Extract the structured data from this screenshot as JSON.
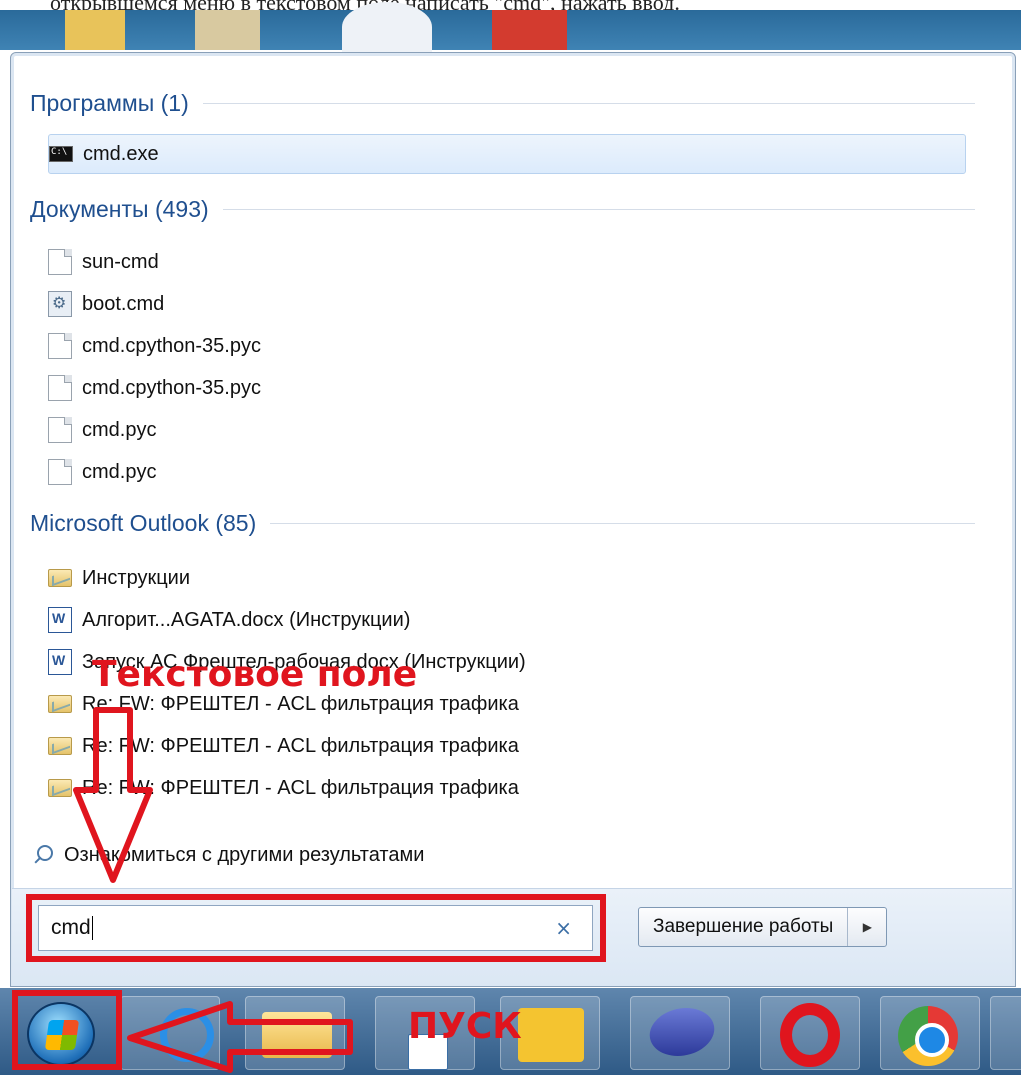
{
  "caption": {
    "text": "открывшемся меню в текстовом поле написать \"cmd\", нажать ввод."
  },
  "start_menu": {
    "sections": [
      {
        "heading": "Программы (1)",
        "items": [
          {
            "label": "cmd.exe",
            "icon": "cmd-icon",
            "selected": true
          }
        ]
      },
      {
        "heading": "Документы (493)",
        "items": [
          {
            "label": "sun-cmd",
            "icon": "document-icon"
          },
          {
            "label": "boot.cmd",
            "icon": "settings-file-icon"
          },
          {
            "label": "cmd.cpython-35.pyc",
            "icon": "document-icon"
          },
          {
            "label": "cmd.cpython-35.pyc",
            "icon": "document-icon"
          },
          {
            "label": "cmd.pyc",
            "icon": "document-icon"
          },
          {
            "label": "cmd.pyc",
            "icon": "document-icon"
          }
        ]
      },
      {
        "heading": "Microsoft Outlook (85)",
        "items": [
          {
            "label": "Инструкции",
            "icon": "mail-folder-icon"
          },
          {
            "label": "Алгорит...AGATA.docx (Инструкции)",
            "icon": "word-icon"
          },
          {
            "label": "Запуск АС Фрештел-рабочая.docx (Инструкции)",
            "icon": "word-icon"
          },
          {
            "label": "Re: FW: ФРЕШТЕЛ - ACL фильтрация трафика",
            "icon": "mail-icon"
          },
          {
            "label": "Re: FW: ФРЕШТЕЛ - ACL фильтрация трафика",
            "icon": "mail-icon"
          },
          {
            "label": "Re: FW: ФРЕШТЕЛ - ACL фильтрация трафика",
            "icon": "mail-icon"
          }
        ]
      }
    ],
    "more_results": "Ознакомиться с другими результатами",
    "search": {
      "value": "cmd",
      "clear_icon": "×"
    },
    "shutdown": {
      "label": "Завершение работы",
      "arrow": "▶"
    }
  },
  "annotations": {
    "field_label": "Текстовое поле",
    "start_label": "ПУСК",
    "color": "#e0151e"
  },
  "taskbar": {
    "apps": [
      "start-orb",
      "internet-explorer-icon",
      "file-explorer-icon",
      "calendar-icon",
      "outlook-icon",
      "laptop-app-icon",
      "opera-icon",
      "chrome-icon"
    ]
  }
}
